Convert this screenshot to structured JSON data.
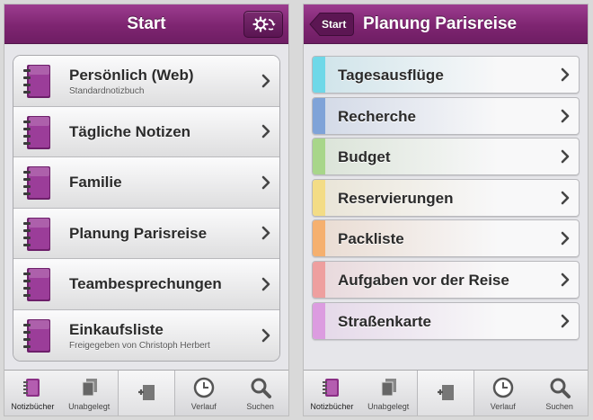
{
  "left": {
    "nav_title": "Start",
    "notebooks": [
      {
        "title": "Persönlich (Web)",
        "subtitle": "Standardnotizbuch"
      },
      {
        "title": "Tägliche Notizen",
        "subtitle": ""
      },
      {
        "title": "Familie",
        "subtitle": ""
      },
      {
        "title": "Planung Parisreise",
        "subtitle": ""
      },
      {
        "title": "Teambesprechungen",
        "subtitle": ""
      },
      {
        "title": "Einkaufsliste",
        "subtitle": "Freigegeben von Christoph Herbert"
      }
    ]
  },
  "right": {
    "back_label": "Start",
    "nav_title": "Planung Parisreise",
    "sections": [
      {
        "title": "Tagesausflüge",
        "color": "#6fd8e8"
      },
      {
        "title": "Recherche",
        "color": "#7fa3d8"
      },
      {
        "title": "Budget",
        "color": "#a8d68a"
      },
      {
        "title": "Reservierungen",
        "color": "#f3dc86"
      },
      {
        "title": "Packliste",
        "color": "#f5b06f"
      },
      {
        "title": "Aufgaben vor der Reise",
        "color": "#ee9f9f"
      },
      {
        "title": "Straßenkarte",
        "color": "#dc9ce0"
      }
    ]
  },
  "tabbar": {
    "notebooks": "Notizbücher",
    "unfiled": "Unabgelegt",
    "recent": "Verlauf",
    "search": "Suchen"
  },
  "colors": {
    "accent": "#7e2571",
    "notebook": "#9b3d99"
  }
}
